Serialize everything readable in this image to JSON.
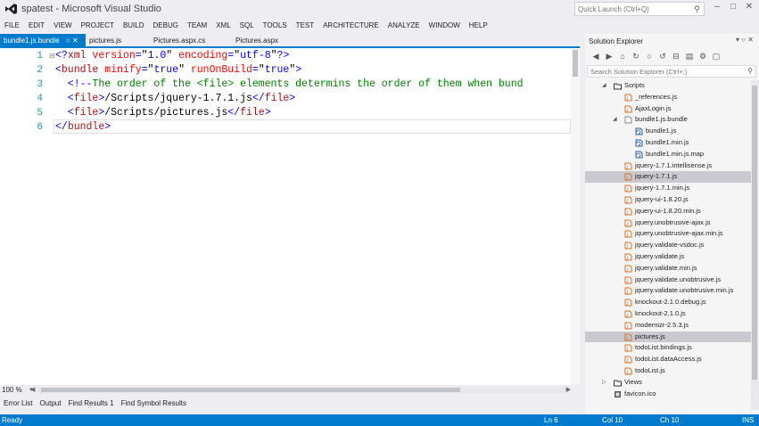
{
  "window": {
    "title": "spatest - Microsoft Visual Studio",
    "quick_launch_placeholder": "Quick Launch (Ctrl+Q)"
  },
  "menu": [
    "FILE",
    "EDIT",
    "VIEW",
    "PROJECT",
    "BUILD",
    "DEBUG",
    "TEAM",
    "XML",
    "SQL",
    "TOOLS",
    "TEST",
    "ARCHITECTURE",
    "ANALYZE",
    "WINDOW",
    "HELP"
  ],
  "tabs": [
    {
      "label": "bundle1.js.bundle",
      "active": true
    },
    {
      "label": "pictures.js",
      "active": false
    },
    {
      "label": "Pictures.aspx.cs",
      "active": false
    },
    {
      "label": "Pictures.aspx",
      "active": false
    }
  ],
  "editor": {
    "line_numbers": [
      "1",
      "2",
      "3",
      "4",
      "5",
      "6"
    ],
    "lines": [
      [
        [
          "c-blue",
          "<?"
        ],
        [
          "c-brown",
          "xml"
        ],
        [
          "c-red",
          " version"
        ],
        [
          "c-blue",
          "="
        ],
        [
          "c-black",
          "\""
        ],
        [
          "c-blue",
          "1.0"
        ],
        [
          "c-black",
          "\""
        ],
        [
          "c-red",
          " encoding"
        ],
        [
          "c-blue",
          "="
        ],
        [
          "c-black",
          "\""
        ],
        [
          "c-blue",
          "utf-8"
        ],
        [
          "c-black",
          "\""
        ],
        [
          "c-blue",
          "?>"
        ]
      ],
      [
        [
          "c-blue",
          "<"
        ],
        [
          "c-brown",
          "bundle"
        ],
        [
          "c-red",
          " minify"
        ],
        [
          "c-blue",
          "="
        ],
        [
          "c-black",
          "\""
        ],
        [
          "c-blue",
          "true"
        ],
        [
          "c-black",
          "\""
        ],
        [
          "c-red",
          " runOnBuild"
        ],
        [
          "c-blue",
          "="
        ],
        [
          "c-black",
          "\""
        ],
        [
          "c-blue",
          "true"
        ],
        [
          "c-black",
          "\""
        ],
        [
          "c-blue",
          ">"
        ]
      ],
      [
        [
          "c-blue",
          "  <!--"
        ],
        [
          "c-green",
          "The order of the <file> elements determins the order of them when bund"
        ]
      ],
      [
        [
          "c-blue",
          "  <"
        ],
        [
          "c-brown",
          "file"
        ],
        [
          "c-blue",
          ">"
        ],
        [
          "c-black",
          "/Scripts/jquery-1.7.1.js"
        ],
        [
          "c-blue",
          "</"
        ],
        [
          "c-brown",
          "file"
        ],
        [
          "c-blue",
          ">"
        ]
      ],
      [
        [
          "c-blue",
          "  <"
        ],
        [
          "c-brown",
          "file"
        ],
        [
          "c-blue",
          ">"
        ],
        [
          "c-black",
          "/Scripts/pictures.js"
        ],
        [
          "c-blue",
          "</"
        ],
        [
          "c-brown",
          "file"
        ],
        [
          "c-blue",
          ">"
        ]
      ],
      [
        [
          "c-blue",
          "</"
        ],
        [
          "c-brown",
          "bundle"
        ],
        [
          "c-blue",
          ">"
        ]
      ]
    ],
    "zoom": "100 %"
  },
  "tool_tabs": [
    "Error List",
    "Output",
    "Find Results 1",
    "Find Symbol Results"
  ],
  "status": {
    "ready": "Ready",
    "line": "Ln 6",
    "col": "Col 10",
    "ch": "Ch 10",
    "mode": "INS"
  },
  "solution_explorer": {
    "title": "Solution Explorer",
    "search_placeholder": "Search Solution Explorer (Ctrl+;)",
    "items": [
      {
        "label": "Scripts",
        "icon": "folder-icon",
        "expanded": true,
        "selected": false
      },
      {
        "label": "_references.js",
        "icon": "js-file-icon",
        "selected": false
      },
      {
        "label": "AjaxLogin.js",
        "icon": "js-file-icon",
        "selected": false
      },
      {
        "label": "bundle1.js.bundle",
        "icon": "bundle-file-icon",
        "expanded": true,
        "selected": false
      },
      {
        "label": "bundle1.js",
        "icon": "generated-file-icon",
        "selected": false
      },
      {
        "label": "bundle1.min.js",
        "icon": "generated-file-icon",
        "selected": false
      },
      {
        "label": "bundle1.min.js.map",
        "icon": "generated-file-icon",
        "selected": false
      },
      {
        "label": "jquery-1.7.1.intellisense.js",
        "icon": "js-file-icon",
        "selected": false
      },
      {
        "label": "jquery-1.7.1.js",
        "icon": "js-file-icon",
        "selected": true
      },
      {
        "label": "jquery-1.7.1.min.js",
        "icon": "js-file-icon",
        "selected": false
      },
      {
        "label": "jquery-ui-1.8.20.js",
        "icon": "js-file-icon",
        "selected": false
      },
      {
        "label": "jquery-ui-1.8.20.min.js",
        "icon": "js-file-icon",
        "selected": false
      },
      {
        "label": "jquery.unobtrusive-ajax.js",
        "icon": "js-file-icon",
        "selected": false
      },
      {
        "label": "jquery.unobtrusive-ajax.min.js",
        "icon": "js-file-icon",
        "selected": false
      },
      {
        "label": "jquery.validate-vsdoc.js",
        "icon": "js-file-icon",
        "selected": false
      },
      {
        "label": "jquery.validate.js",
        "icon": "js-file-icon",
        "selected": false
      },
      {
        "label": "jquery.validate.min.js",
        "icon": "js-file-icon",
        "selected": false
      },
      {
        "label": "jquery.validate.unobtrusive.js",
        "icon": "js-file-icon",
        "selected": false
      },
      {
        "label": "jquery.validate.unobtrusive.min.js",
        "icon": "js-file-icon",
        "selected": false
      },
      {
        "label": "knockout-2.1.0.debug.js",
        "icon": "js-file-icon",
        "selected": false
      },
      {
        "label": "knockout-2.1.0.js",
        "icon": "js-file-icon",
        "selected": false
      },
      {
        "label": "modernizr-2.5.3.js",
        "icon": "js-file-icon",
        "selected": false
      },
      {
        "label": "pictures.js",
        "icon": "js-file-icon",
        "selected": true
      },
      {
        "label": "todoList.bindings.js",
        "icon": "js-file-icon",
        "selected": false
      },
      {
        "label": "todoList.dataAccess.js",
        "icon": "js-file-icon",
        "selected": false
      },
      {
        "label": "todoList.js",
        "icon": "js-file-icon",
        "selected": false
      },
      {
        "label": "Views",
        "icon": "folder-icon",
        "expanded": false,
        "selected": false
      },
      {
        "label": "favicon.ico",
        "icon": "ico-file-icon",
        "selected": false
      }
    ]
  },
  "colors": {
    "accent": "#007acc",
    "js_icon": "#e07020",
    "folder": "#333333"
  }
}
